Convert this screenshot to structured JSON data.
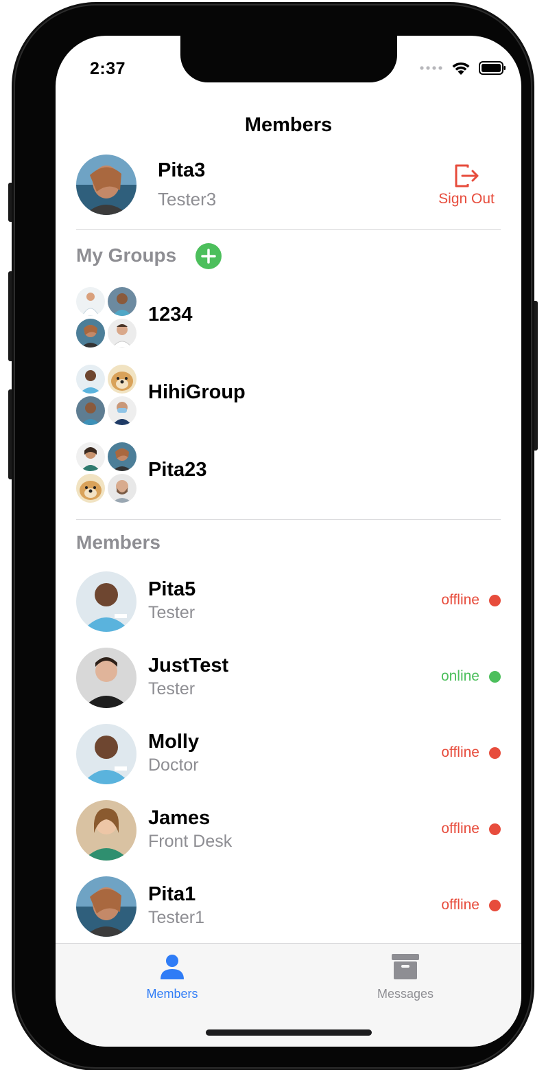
{
  "status_bar": {
    "time": "2:37"
  },
  "nav": {
    "title": "Members"
  },
  "profile": {
    "name": "Pita3",
    "role": "Tester3",
    "sign_out_label": "Sign Out"
  },
  "groups_section": {
    "title": "My Groups",
    "groups": [
      {
        "name": "1234"
      },
      {
        "name": "HihiGroup"
      },
      {
        "name": "Pita23"
      }
    ]
  },
  "members_section": {
    "title": "Members",
    "members": [
      {
        "name": "Pita5",
        "role": "Tester",
        "status": "offline"
      },
      {
        "name": "JustTest",
        "role": "Tester",
        "status": "online"
      },
      {
        "name": "Molly",
        "role": "Doctor",
        "status": "offline"
      },
      {
        "name": "James",
        "role": "Front Desk",
        "status": "offline"
      },
      {
        "name": "Pita1",
        "role": "Tester1",
        "status": "offline"
      }
    ]
  },
  "tabs": [
    {
      "label": "Members",
      "icon": "person-icon",
      "active": true
    },
    {
      "label": "Messages",
      "icon": "archive-icon",
      "active": false
    }
  ],
  "colors": {
    "online": "#4cbf5c",
    "offline": "#e74c3c",
    "tab_active": "#2f7cf6",
    "tab_inactive": "#8e8e93",
    "sign_out": "#e74c3c",
    "add_button": "#4cbf5c"
  }
}
